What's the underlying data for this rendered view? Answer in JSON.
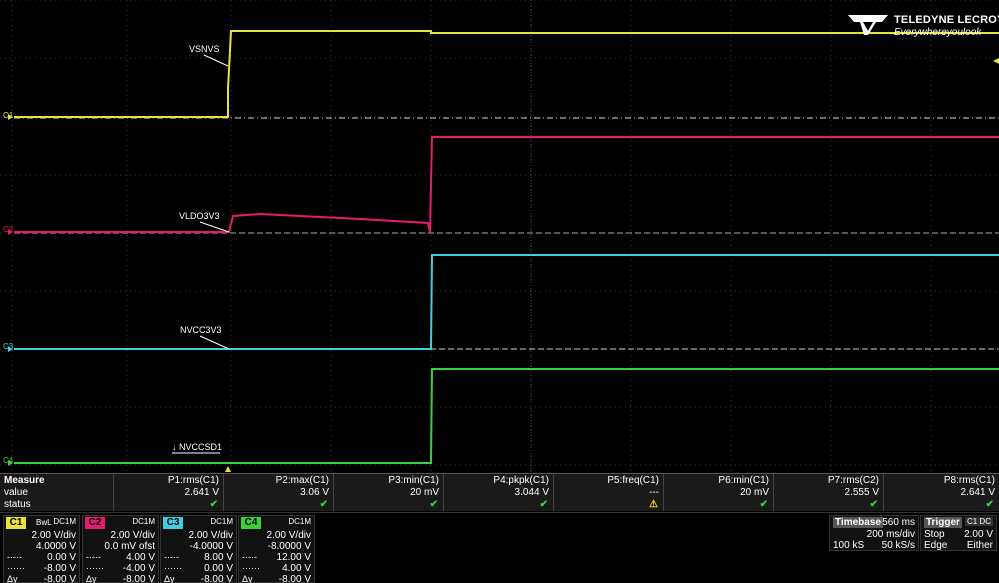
{
  "brand": {
    "name": "TELEDYNE LECROY",
    "tagline": "Everywhereyoulook"
  },
  "traces": [
    {
      "id": "C1",
      "label": "VSNVS",
      "color": "#e8e23a"
    },
    {
      "id": "C2",
      "label": "VLDO3V3",
      "color": "#e8196e"
    },
    {
      "id": "C3",
      "label": "NVCC3V3",
      "color": "#3ed0e0"
    },
    {
      "id": "C4",
      "label": "NVCCSD1",
      "color": "#3ad13a"
    }
  ],
  "channel_markers": {
    "c1": "C1",
    "c2": "C2",
    "c3": "C3",
    "c4": "C4"
  },
  "measure": {
    "title": "Measure",
    "row_value": "value",
    "row_status": "status",
    "params": [
      {
        "name": "P1:rms(C1)",
        "value": "2.641 V",
        "status": "ok"
      },
      {
        "name": "P2:max(C1)",
        "value": "3.06 V",
        "status": "ok"
      },
      {
        "name": "P3:min(C1)",
        "value": "20 mV",
        "status": "ok"
      },
      {
        "name": "P4:pkpk(C1)",
        "value": "3.044 V",
        "status": "ok"
      },
      {
        "name": "P5:freq(C1)",
        "value": "---",
        "status": "warn"
      },
      {
        "name": "P6:min(C1)",
        "value": "20 mV",
        "status": "ok"
      },
      {
        "name": "P7:rms(C2)",
        "value": "2.555 V",
        "status": "ok"
      },
      {
        "name": "P8:rms(C1)",
        "value": "2.641 V",
        "status": "ok"
      }
    ]
  },
  "channels": [
    {
      "id": "C1",
      "bw": "BwL",
      "coupling": "DC1M",
      "vdiv": "2.00 V/div",
      "offset": "4.0000 V",
      "l1": "0.00 V",
      "l2": "-8.00 V",
      "dy": "-8.00 V",
      "sym1": "",
      "sym2": "",
      "color": "#e8e23a"
    },
    {
      "id": "C2",
      "bw": "",
      "coupling": "DC1M",
      "vdiv": "2.00 V/div",
      "offset": "0.0 mV ofst",
      "l1": "4.00 V",
      "l2": "-4.00 V",
      "dy": "-8.00 V",
      "sym1": "",
      "sym2": "",
      "color": "#e8196e"
    },
    {
      "id": "C3",
      "bw": "",
      "coupling": "DC1M",
      "vdiv": "2.00 V/div",
      "offset": "-4.0000 V",
      "l1": "8.00 V",
      "l2": "0.00 V",
      "dy": "-8.00 V",
      "sym1": "",
      "sym2": "",
      "color": "#3ed0e0"
    },
    {
      "id": "C4",
      "bw": "",
      "coupling": "DC1M",
      "vdiv": "2.00 V/div",
      "offset": "-8.0000 V",
      "l1": "12.00 V",
      "l2": "4.00 V",
      "dy": "-8.00 V",
      "sym1": "",
      "sym2": "",
      "color": "#3ad13a"
    }
  ],
  "dy_label": "Δy",
  "timebase": {
    "title": "Timebase",
    "delay": "-560 ms",
    "tdiv": "200 ms/div",
    "samples": "100 kS",
    "rate": "50 kS/s"
  },
  "trigger": {
    "title": "Trigger",
    "source": "C1 DC",
    "mode": "Stop",
    "level": "2.00 V",
    "type": "Edge",
    "slope": "Either"
  }
}
